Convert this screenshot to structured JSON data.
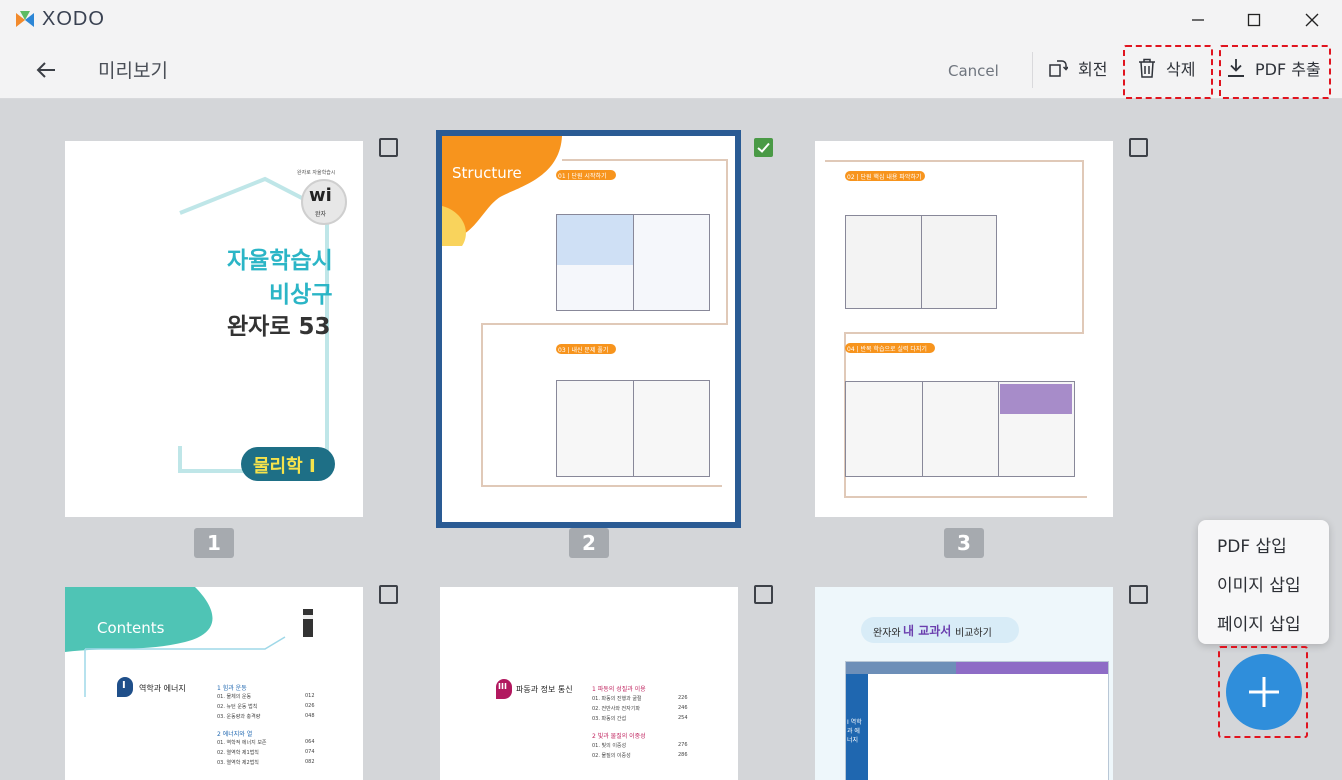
{
  "app": {
    "name": "XODO"
  },
  "toolbar": {
    "title": "미리보기",
    "cancel": "Cancel",
    "rotate": "회전",
    "delete": "삭제",
    "extract": "PDF 추출"
  },
  "icons": {
    "back": "arrow-left-icon",
    "rotate": "rotate-icon",
    "delete": "trash-icon",
    "extract": "download-icon",
    "add": "plus-icon"
  },
  "pages": [
    {
      "number": "1",
      "selected": false
    },
    {
      "number": "2",
      "selected": true
    },
    {
      "number": "3",
      "selected": false
    },
    {
      "number": "",
      "selected": false
    },
    {
      "number": "",
      "selected": false
    },
    {
      "number": "",
      "selected": false
    }
  ],
  "page1": {
    "badge_top": "완자로 자율학습시",
    "badge_letters": "wi",
    "badge_sub": "완자",
    "line1": "자율학습시",
    "line2": "비상구",
    "line3": "완자로 53",
    "subject": "물리학 Ⅰ"
  },
  "page2": {
    "heading": "Structure",
    "sec1": "01 | 단원 시작하기",
    "sec2": "03 | 내신 문제 풀기"
  },
  "page3": {
    "sec1": "02 | 단원 핵심 내용 파악하기",
    "sec2": "04 | 반복 학습으로 실력 다지기"
  },
  "page4": {
    "heading": "Contents",
    "unit_numeral": "I",
    "unit_title": "역학과 에너지",
    "group1": "1 힘과 운동",
    "items1": [
      "01. 물체의 운동",
      "02. 뉴턴 운동 법칙",
      "03. 운동량과 충격량"
    ],
    "pages1": [
      "012",
      "026",
      "048"
    ],
    "group2": "2 에너지와 열",
    "items2": [
      "01. 역학적 에너지 보존",
      "02. 열역학 제1법칙",
      "03. 열역학 제2법칙"
    ],
    "pages2": [
      "064",
      "074",
      "082"
    ]
  },
  "page5": {
    "unit_numeral": "III",
    "unit_title": "파동과 정보 통신",
    "group1": "1 파동의 성질과 이용",
    "items1": [
      "01. 파동의 진행과 굴절",
      "02. 전반사와 전자기파",
      "03. 파동의 간섭"
    ],
    "pages1": [
      "226",
      "246",
      "254"
    ],
    "group2": "2 빛과 물질의 이중성",
    "items2": [
      "01. 빛의 이중성",
      "02. 물질의 이중성"
    ],
    "pages2": [
      "276",
      "286"
    ]
  },
  "page6": {
    "heading_part1": "완자와",
    "heading_part2": "내 교과서",
    "heading_part3": "비교하기",
    "unit": "Ⅰ 역학과 에너지"
  },
  "menu": {
    "items": [
      "PDF 삽입",
      "이미지 삽입",
      "페이지 삽입"
    ]
  },
  "colors": {
    "selection": "#2a5b94",
    "check": "#4a9a46",
    "fab": "#2f8edb",
    "highlight": "#e0141f"
  }
}
